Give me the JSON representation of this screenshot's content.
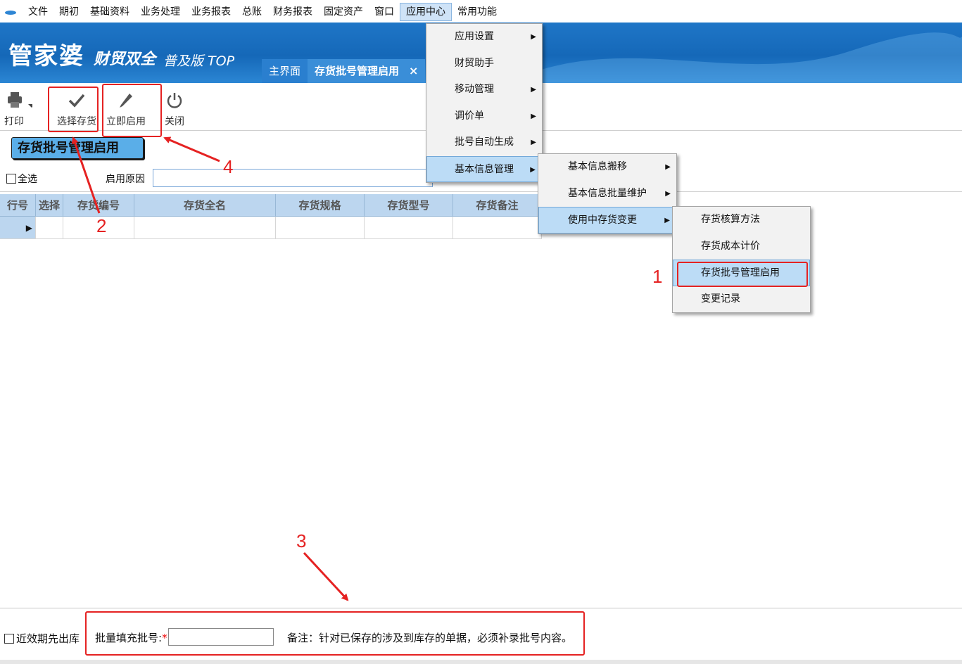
{
  "menubar": {
    "items": [
      "文件",
      "期初",
      "基础资料",
      "业务处理",
      "业务报表",
      "总账",
      "财务报表",
      "固定资产",
      "窗口",
      "应用中心",
      "常用功能"
    ],
    "active": "应用中心"
  },
  "banner": {
    "logo_main": "管家婆",
    "logo_sub": "财贸双全",
    "logo_version": "普及版 TOP",
    "tabs": {
      "home": "主界面",
      "current": "存货批号管理启用",
      "close_glyph": "×"
    }
  },
  "toolbar": {
    "print": "打印",
    "select_inventory": "选择存货",
    "enable_now": "立即启用",
    "close": "关闭"
  },
  "page": {
    "section_title": "存货批号管理启用",
    "select_all": "全选",
    "reason_label": "启用原因",
    "reason_value": ""
  },
  "grid": {
    "columns": [
      "行号",
      "选择",
      "存货编号",
      "存货全名",
      "存货规格",
      "存货型号",
      "存货备注"
    ],
    "row_indicator": "▶"
  },
  "menus": {
    "app_center": [
      {
        "label": "应用设置",
        "submenu": true
      },
      {
        "label": "财贸助手",
        "submenu": false
      },
      {
        "label": "移动管理",
        "submenu": true
      },
      {
        "label": "调价单",
        "submenu": true
      },
      {
        "label": "批号自动生成",
        "submenu": true
      },
      {
        "label": "基本信息管理",
        "submenu": true,
        "selected": true
      }
    ],
    "basic_info": [
      {
        "label": "基本信息搬移",
        "submenu": true
      },
      {
        "label": "基本信息批量维护",
        "submenu": true
      },
      {
        "label": "使用中存货变更",
        "submenu": true,
        "selected": true
      }
    ],
    "inventory_change": [
      {
        "label": "存货核算方法"
      },
      {
        "label": "存货成本计价"
      },
      {
        "label": "存货批号管理启用",
        "selected": true
      },
      {
        "label": "变更记录"
      }
    ],
    "arrow_glyph": "▶"
  },
  "bottom": {
    "near_expiry": "近效期先出库",
    "batch_fill_label": "批量填充批号:",
    "required_mark": "*",
    "batch_fill_value": "",
    "note": "备注：针对已保存的涉及到库存的单据，必须补录批号内容。"
  },
  "annotations": {
    "labels": [
      "1",
      "2",
      "3",
      "4"
    ],
    "color": "#e52222"
  },
  "colors": {
    "banner_blue": "#1f76c7",
    "grid_header": "#bcd6ef",
    "menu_selected": "#bcdcf6",
    "section_button": "#5aaee8"
  }
}
